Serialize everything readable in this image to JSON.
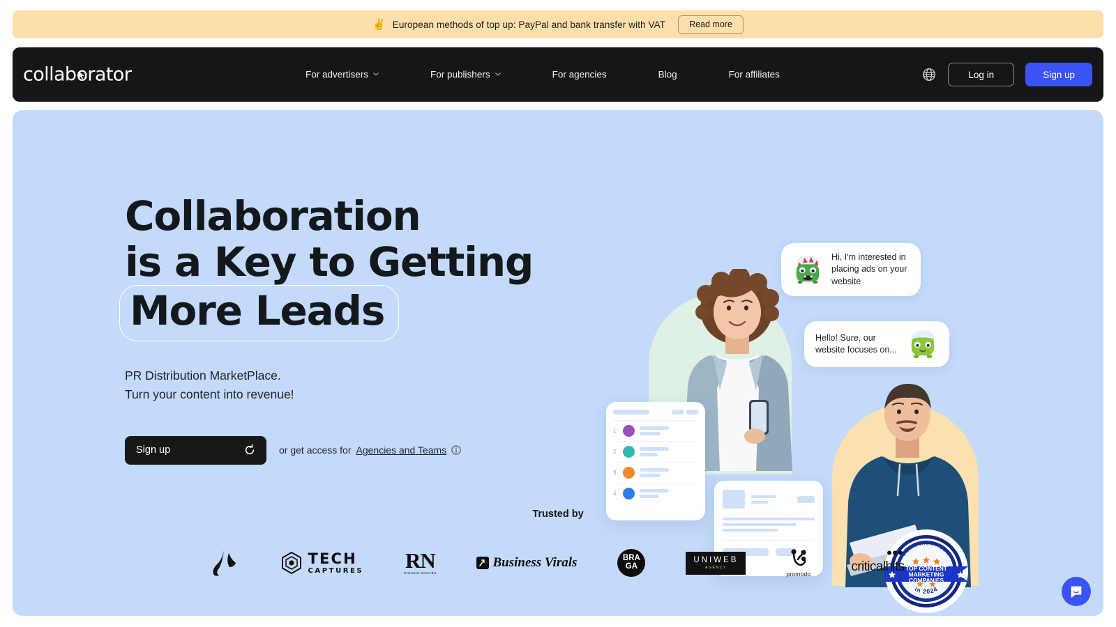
{
  "promo_banner": {
    "emoji": "✌️",
    "emoji_name": "victory-hand-emoji",
    "text": "European methods of top up: PayPal and bank transfer with VAT",
    "button_label": "Read more",
    "background_color": "#fcdfab"
  },
  "header": {
    "logo_text_before": "collab",
    "logo_text_o": "o",
    "logo_text_after": "rator",
    "logo_full": "collaborator",
    "background_color": "#161616",
    "nav": [
      {
        "label": "For advertisers",
        "has_dropdown": true
      },
      {
        "label": "For publishers",
        "has_dropdown": true
      },
      {
        "label": "For agencies",
        "has_dropdown": false
      },
      {
        "label": "Blog",
        "has_dropdown": false
      },
      {
        "label": "For affiliates",
        "has_dropdown": false
      }
    ],
    "language_icon": "globe-icon",
    "login_label": "Log in",
    "signup_label": "Sign up",
    "signup_color": "#3b53f5"
  },
  "hero": {
    "background_color": "#c3dafa",
    "headline_line1": "Collaboration",
    "headline_line2": "is a Key to Getting",
    "headline_line3": "More Leads",
    "subtitle_line1": "PR Distribution MarketPlace.",
    "subtitle_line2": "Turn your content into revenue!",
    "cta_label": "Sign up",
    "cta_icon": "refresh-icon",
    "cta_note_prefix": "or get access for",
    "cta_note_link": "Agencies and Teams",
    "cta_note_icon": "info-icon"
  },
  "illustration": {
    "bubble1_text": "Hi, I'm interested in placing ads on your website",
    "bubble1_avatar": "green-monster-avatar",
    "bubble2_text": "Hello! Sure, our website focuses on...",
    "bubble2_avatar": "green-monster-avatar-2",
    "list_card": {
      "rows": [
        {
          "number": "1",
          "color": "#9b4fbe"
        },
        {
          "number": "2",
          "color": "#32b6ae"
        },
        {
          "number": "3",
          "color": "#f08a2a"
        },
        {
          "number": "4",
          "color": "#2d7df0"
        }
      ]
    },
    "badge": {
      "arc_text": "DESIGNRUSH.COM",
      "line1": "TOP CONTENT",
      "line2": "MARKETING",
      "line3": "COMPANIES",
      "year_text": "in 2024",
      "color": "#1b36c4"
    }
  },
  "trusted": {
    "title": "Trusted by",
    "logos": [
      {
        "name": "swoosh-mark-logo",
        "text": ""
      },
      {
        "name": "tech-captures-logo",
        "text_main": "TECH",
        "text_sub": "CAPTURES"
      },
      {
        "name": "rn-logo",
        "text_main": "RN",
        "text_sub": "ROSARIO NUESTRO"
      },
      {
        "name": "business-virals-logo",
        "text": "Business Virals"
      },
      {
        "name": "braga-logo",
        "text_main": "BRA",
        "text_sub": "GA"
      },
      {
        "name": "uniweb-logo",
        "text_main": "UNIWEB",
        "text_sub": "AGENCY"
      },
      {
        "name": "promodo-logo",
        "text": "promodo"
      },
      {
        "name": "criticalhits-logo",
        "text": "criticalhits"
      }
    ]
  },
  "chat_widget": {
    "icon": "chat-bubble-icon",
    "color": "#3b53f5"
  }
}
